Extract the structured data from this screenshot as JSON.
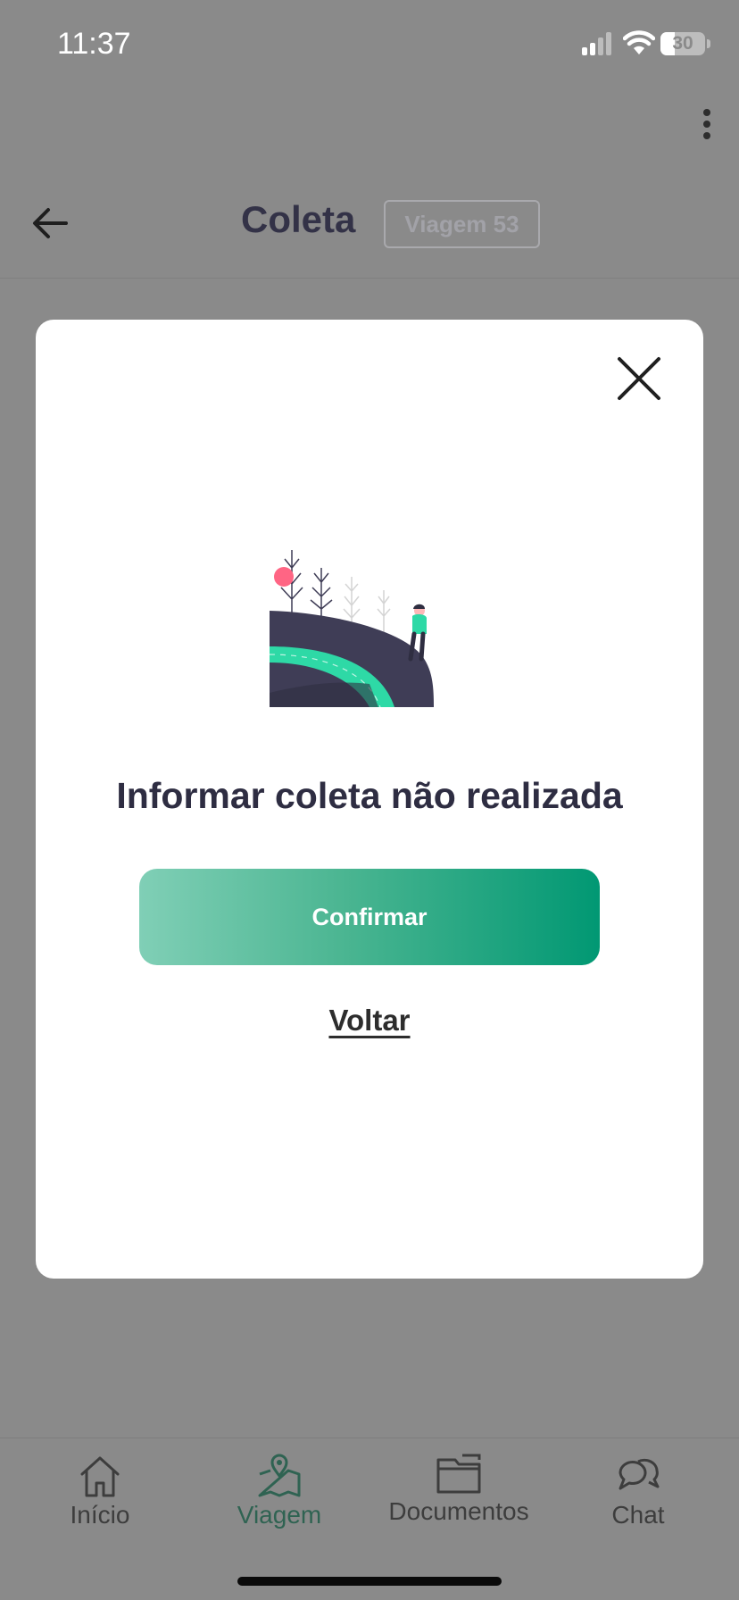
{
  "status_bar": {
    "time": "11:37",
    "battery": "30"
  },
  "header": {
    "title": "Coleta",
    "badge": "Viagem 53"
  },
  "modal": {
    "title": "Informar coleta não realizada",
    "confirm_label": "Confirmar",
    "back_label": "Voltar"
  },
  "nav": {
    "items": [
      {
        "label": "Início",
        "icon": "home-icon"
      },
      {
        "label": "Viagem",
        "icon": "map-pin-icon",
        "active": true
      },
      {
        "label": "Documentos",
        "icon": "folder-icon"
      },
      {
        "label": "Chat",
        "icon": "chat-icon"
      }
    ]
  },
  "colors": {
    "accent": "#019873",
    "accent_light": "#80cfb6",
    "overlay": "#8a8a8a",
    "title_text": "#2e2d42"
  }
}
